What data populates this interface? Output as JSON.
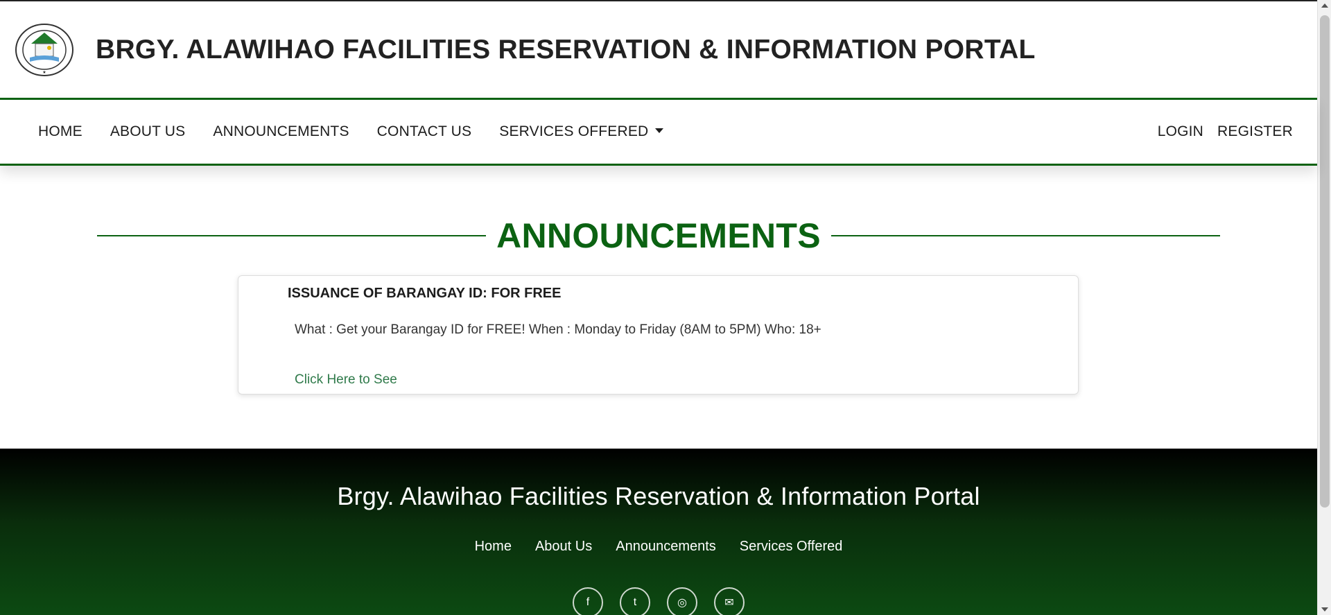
{
  "header": {
    "title": "BRGY. ALAWIHAO FACILITIES RESERVATION & INFORMATION PORTAL"
  },
  "nav": {
    "left": [
      "HOME",
      "ABOUT US",
      "ANNOUNCEMENTS",
      "CONTACT US"
    ],
    "services_label": "SERVICES OFFERED",
    "login": "LOGIN",
    "register": "REGISTER"
  },
  "main": {
    "heading": "ANNOUNCEMENTS",
    "announcement": {
      "title": "ISSUANCE OF BARANGAY ID: FOR FREE",
      "text": "What : Get your Barangay ID for FREE! When : Monday to Friday (8AM to 5PM) Who: 18+",
      "link": "Click Here to See"
    }
  },
  "footer": {
    "title": "Brgy. Alawihao Facilities Reservation & Information Portal",
    "links": [
      "Home",
      "About Us",
      "Announcements",
      "Services Offered"
    ],
    "socials": [
      "facebook-icon",
      "twitter-icon",
      "instagram-icon",
      "email-icon"
    ]
  },
  "colors": {
    "brand_green": "#0b6212",
    "link_green": "#2f7a4a"
  }
}
